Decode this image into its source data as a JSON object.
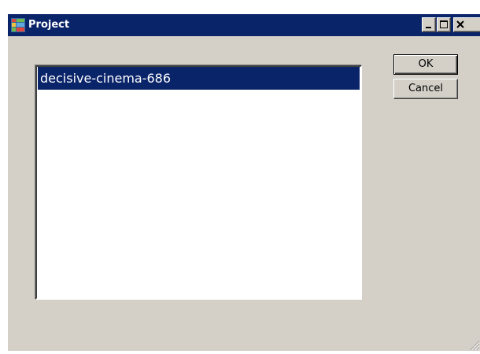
{
  "window": {
    "title": "Project",
    "app_icon": "project-icon",
    "caption_buttons": [
      "minimize-icon",
      "maximize-icon",
      "close-icon"
    ]
  },
  "project_list": {
    "items": [
      {
        "label": "decisive-cinema-686",
        "selected": true
      }
    ]
  },
  "buttons": {
    "ok_label": "OK",
    "cancel_label": "Cancel"
  },
  "colors": {
    "titlebar": "#0a246a",
    "face": "#d4d0c8",
    "selection": "#0a246a",
    "list_background": "#ffffff"
  }
}
